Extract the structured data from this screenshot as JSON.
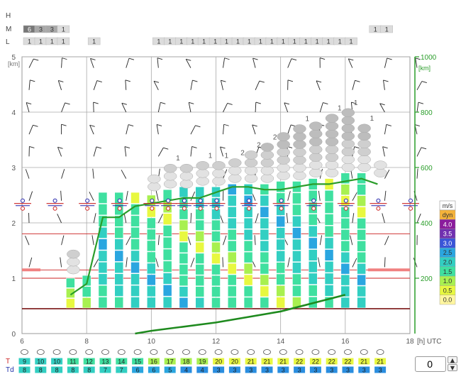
{
  "chart_data": {
    "type": "meteogram",
    "row_labels": {
      "high": "H",
      "mid": "M",
      "low": "L"
    },
    "axis": {
      "y_left_label": "[km]",
      "y_left_ticks": [
        "0",
        "1",
        "2",
        "3",
        "4",
        "5"
      ],
      "y_right_label": "[km]",
      "y_right_ticks": [
        "200",
        "400",
        "600",
        "800",
        "1000"
      ],
      "x_ticks": [
        "6",
        "8",
        "10",
        "12",
        "14",
        "16",
        "18"
      ],
      "x_unit": "[h] UTC",
      "x_range": [
        6,
        18
      ],
      "y_range_km": [
        0,
        5
      ],
      "y_right_range": [
        0,
        1000
      ]
    },
    "cloud_cover_mid": [
      {
        "x": 6.0,
        "value": "6"
      },
      {
        "x": 6.35,
        "value": "3"
      },
      {
        "x": 6.7,
        "value": "3"
      },
      {
        "x": 7.05,
        "value": "1"
      },
      {
        "x": 16.7,
        "value": "1"
      },
      {
        "x": 17.05,
        "value": "1"
      }
    ],
    "cloud_cover_low": [
      {
        "x": 6.0,
        "value": "1"
      },
      {
        "x": 6.35,
        "value": "1"
      },
      {
        "x": 6.7,
        "value": "1"
      },
      {
        "x": 7.05,
        "value": "1"
      },
      {
        "x": 8.0,
        "value": "1"
      },
      {
        "x": 10.0,
        "value": "1"
      },
      {
        "x": 10.35,
        "value": "1"
      },
      {
        "x": 10.7,
        "value": "1"
      },
      {
        "x": 11.05,
        "value": "1"
      },
      {
        "x": 11.4,
        "value": "1"
      },
      {
        "x": 11.75,
        "value": "1"
      },
      {
        "x": 12.1,
        "value": "1"
      },
      {
        "x": 12.45,
        "value": "1"
      },
      {
        "x": 12.8,
        "value": "1"
      },
      {
        "x": 13.15,
        "value": "1"
      },
      {
        "x": 13.5,
        "value": "1"
      },
      {
        "x": 13.85,
        "value": "1"
      },
      {
        "x": 14.2,
        "value": "1"
      },
      {
        "x": 14.55,
        "value": "1"
      },
      {
        "x": 14.9,
        "value": "1"
      },
      {
        "x": 15.25,
        "value": "1"
      },
      {
        "x": 15.6,
        "value": "1"
      },
      {
        "x": 15.95,
        "value": "1"
      }
    ],
    "thermal_columns": [
      {
        "x": 7.5,
        "top_km": 1.0
      },
      {
        "x": 8.0,
        "top_km": 1.05
      },
      {
        "x": 8.5,
        "top_km": 2.55
      },
      {
        "x": 9.0,
        "top_km": 2.55
      },
      {
        "x": 9.5,
        "top_km": 2.55
      },
      {
        "x": 10.0,
        "top_km": 2.5
      },
      {
        "x": 10.5,
        "top_km": 2.6
      },
      {
        "x": 11.0,
        "top_km": 2.65
      },
      {
        "x": 11.5,
        "top_km": 2.65
      },
      {
        "x": 12.0,
        "top_km": 2.65
      },
      {
        "x": 12.5,
        "top_km": 2.7
      },
      {
        "x": 13.0,
        "top_km": 2.7
      },
      {
        "x": 13.5,
        "top_km": 2.7
      },
      {
        "x": 14.0,
        "top_km": 2.75
      },
      {
        "x": 14.5,
        "top_km": 2.75
      },
      {
        "x": 15.0,
        "top_km": 2.8
      },
      {
        "x": 15.5,
        "top_km": 2.8
      },
      {
        "x": 16.0,
        "top_km": 2.9
      },
      {
        "x": 16.5,
        "top_km": 2.9
      }
    ],
    "cumulus_bubbles": [
      {
        "x": 10.0,
        "base_km": 2.55,
        "levels": 2,
        "label": ""
      },
      {
        "x": 10.5,
        "base_km": 2.6,
        "levels": 3,
        "label": "1"
      },
      {
        "x": 11.0,
        "base_km": 2.6,
        "levels": 3,
        "label": ""
      },
      {
        "x": 11.5,
        "base_km": 2.65,
        "levels": 3,
        "label": "1"
      },
      {
        "x": 12.0,
        "base_km": 2.65,
        "levels": 3,
        "label": "1"
      },
      {
        "x": 12.5,
        "base_km": 2.7,
        "levels": 3,
        "label": "2"
      },
      {
        "x": 13.0,
        "base_km": 2.7,
        "levels": 4,
        "label": "2"
      },
      {
        "x": 13.5,
        "base_km": 2.7,
        "levels": 5,
        "label": "2"
      },
      {
        "x": 14.0,
        "base_km": 2.75,
        "levels": 6,
        "label": ""
      },
      {
        "x": 14.5,
        "base_km": 2.75,
        "levels": 7,
        "label": "1"
      },
      {
        "x": 15.0,
        "base_km": 2.8,
        "levels": 7,
        "label": ""
      },
      {
        "x": 15.5,
        "base_km": 2.8,
        "levels": 8,
        "label": "1"
      },
      {
        "x": 16.0,
        "base_km": 2.9,
        "levels": 8,
        "label": "1"
      },
      {
        "x": 16.5,
        "base_km": 2.9,
        "levels": 6,
        "label": "1"
      },
      {
        "x": 17.0,
        "base_km": 2.8,
        "levels": 2,
        "label": ""
      },
      {
        "x": 7.5,
        "base_km": 1.05,
        "levels": 3,
        "label": ""
      }
    ],
    "thermal_top_line": [
      [
        7.5,
        0.7
      ],
      [
        8.0,
        0.9
      ],
      [
        8.5,
        2.1
      ],
      [
        9.0,
        2.1
      ],
      [
        9.5,
        2.3
      ],
      [
        10.0,
        2.35
      ],
      [
        10.5,
        2.4
      ],
      [
        11.0,
        2.45
      ],
      [
        11.5,
        2.45
      ],
      [
        12.0,
        2.55
      ],
      [
        12.5,
        2.65
      ],
      [
        13.0,
        2.65
      ],
      [
        13.5,
        2.6
      ],
      [
        14.0,
        2.6
      ],
      [
        14.5,
        2.65
      ],
      [
        15.0,
        2.7
      ],
      [
        15.5,
        2.7
      ],
      [
        16.0,
        2.75
      ],
      [
        16.5,
        2.8
      ],
      [
        17.0,
        2.7
      ]
    ],
    "boundary_layer_line": [
      [
        9.5,
        0.0
      ],
      [
        10.0,
        0.05
      ],
      [
        12.0,
        0.2
      ],
      [
        14.0,
        0.4
      ],
      [
        16.0,
        0.7
      ]
    ],
    "cloud_base_markers": [
      6.0,
      7.0,
      8.0,
      9.0,
      10.0,
      10.5,
      11.0,
      11.5,
      12.0,
      13.0,
      14.0,
      15.0,
      16.0,
      17.0,
      18.0
    ],
    "red_levels_km": [
      0.45,
      1.0,
      1.15,
      1.8
    ],
    "wind_speed_scale": {
      "unit": "m/s",
      "entries": [
        {
          "label": "dyn",
          "color": "#f4b23a"
        },
        {
          "label": "4.0",
          "color": "#8b1c9c"
        },
        {
          "label": "3.5",
          "color": "#7030b0"
        },
        {
          "label": "3.0",
          "color": "#3a55d8"
        },
        {
          "label": "2.5",
          "color": "#2aa6e0"
        },
        {
          "label": "2.0",
          "color": "#32cfc2"
        },
        {
          "label": "1.5",
          "color": "#3fe0a0"
        },
        {
          "label": "1.0",
          "color": "#a8f050"
        },
        {
          "label": "0.5",
          "color": "#e8f840"
        },
        {
          "label": "0.0",
          "color": "#fff6a0"
        }
      ]
    },
    "surface_T": {
      "label": "T",
      "values": [
        "9",
        "10",
        "10",
        "11",
        "12",
        "13",
        "14",
        "15",
        "16",
        "17",
        "18",
        "19",
        "20",
        "20",
        "21",
        "21",
        "21",
        "22",
        "22",
        "22",
        "22",
        "21",
        "21"
      ]
    },
    "surface_Td": {
      "label": "Td",
      "values": [
        "8",
        "8",
        "8",
        "8",
        "8",
        "7",
        "7",
        "6",
        "6",
        "5",
        "4",
        "4",
        "3",
        "3",
        "3",
        "3",
        "3",
        "3",
        "3",
        "3",
        "3",
        "3",
        "3"
      ]
    },
    "spinner_value": "0",
    "colors": {
      "thermal_line": "#2a9d2a",
      "grid": "#888888",
      "red_line": "#cc2222",
      "T_text": "#cc2222",
      "Td_text": "#2233aa"
    }
  }
}
